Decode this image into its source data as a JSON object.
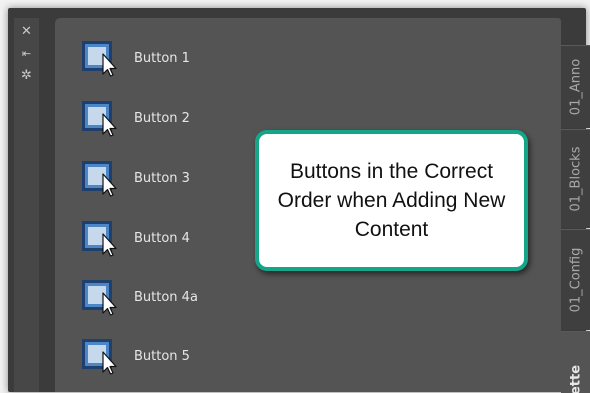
{
  "palette": {
    "window_controls": [
      {
        "name": "close",
        "glyph": "✕"
      },
      {
        "name": "auto-hide",
        "glyph": "⇤"
      },
      {
        "name": "properties",
        "glyph": "✲"
      }
    ],
    "tools": [
      {
        "label": "Button 1"
      },
      {
        "label": "Button 2"
      },
      {
        "label": "Button 3"
      },
      {
        "label": "Button 4"
      },
      {
        "label": "Button 4a"
      },
      {
        "label": "Button 5"
      }
    ],
    "tabs": [
      {
        "label": "01_Anno",
        "active": false
      },
      {
        "label": "01_Blocks",
        "active": false
      },
      {
        "label": "01_Config",
        "active": false
      },
      {
        "label": "ette",
        "active": true
      }
    ]
  },
  "callout": {
    "text": "Buttons in the Correct Order when Adding New Content"
  },
  "colors": {
    "panel_bg": "#545454",
    "titlebar_bg": "#474747",
    "tab_bg": "#3f3f3f",
    "callout_border": "#17a589",
    "callout_bg": "#ffffff"
  }
}
